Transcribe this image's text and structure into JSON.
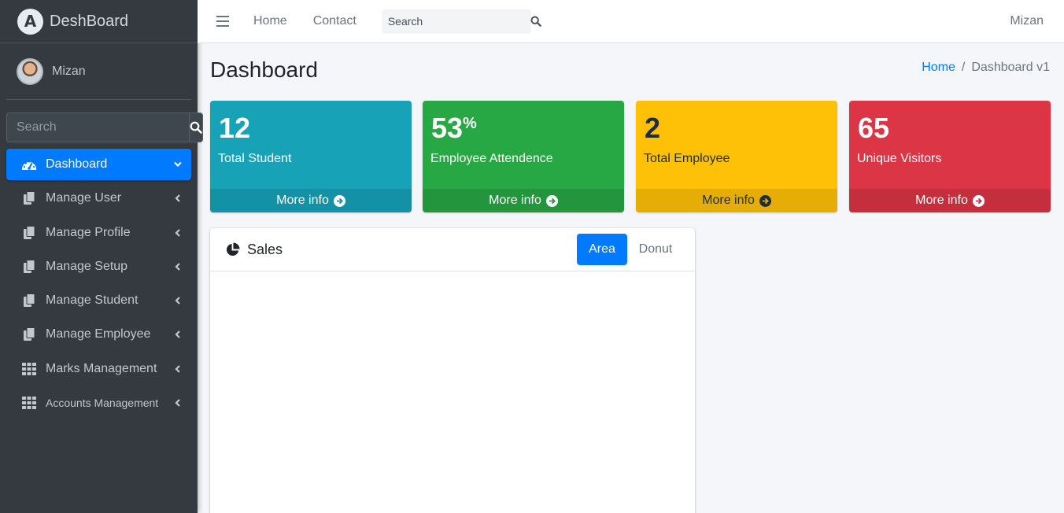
{
  "brand": {
    "logo_letter": "A",
    "name": "DeshBoard"
  },
  "user": {
    "name": "Mizan"
  },
  "sidebar": {
    "search_placeholder": "Search",
    "items": [
      {
        "label": "Dashboard",
        "icon": "tachometer-icon",
        "active": true
      },
      {
        "label": "Manage User",
        "icon": "copy-icon"
      },
      {
        "label": "Manage Profile",
        "icon": "copy-icon"
      },
      {
        "label": "Manage Setup",
        "icon": "copy-icon"
      },
      {
        "label": "Manage Student",
        "icon": "copy-icon"
      },
      {
        "label": "Manage Employee",
        "icon": "copy-icon"
      },
      {
        "label": "Marks Management",
        "icon": "grid-icon"
      },
      {
        "label": "Accounts Management",
        "icon": "grid-icon"
      }
    ]
  },
  "navbar": {
    "links": [
      "Home",
      "Contact"
    ],
    "search_placeholder": "Search",
    "user": "Mizan"
  },
  "header": {
    "title": "Dashboard",
    "breadcrumb": {
      "home": "Home",
      "separator": "/",
      "current": "Dashboard v1"
    }
  },
  "boxes": [
    {
      "value": "12",
      "suffix": "",
      "label": "Total Student",
      "footer": "More info",
      "color": "#17a2b8"
    },
    {
      "value": "53",
      "suffix": "%",
      "label": "Employee Attendence",
      "footer": "More info",
      "color": "#28a745"
    },
    {
      "value": "2",
      "suffix": "",
      "label": "Total Employee",
      "footer": "More info",
      "color": "#ffc107"
    },
    {
      "value": "65",
      "suffix": "",
      "label": "Unique Visitors",
      "footer": "More info",
      "color": "#dc3545"
    }
  ],
  "sales_card": {
    "title": "Sales",
    "tabs": [
      "Area",
      "Donut"
    ],
    "active_tab": "Area"
  },
  "colors": {
    "sidebar_bg": "#343a40",
    "primary": "#007bff",
    "content_bg": "#f4f6f9"
  }
}
